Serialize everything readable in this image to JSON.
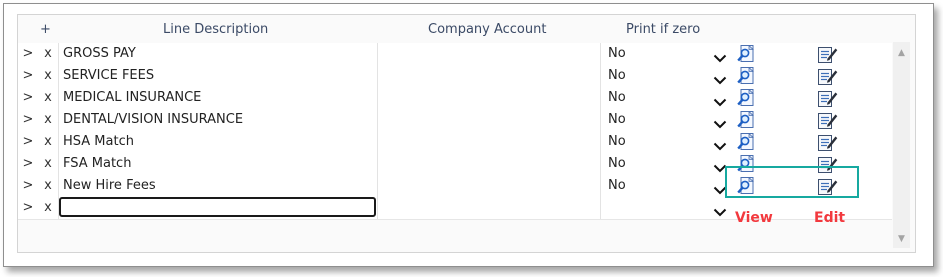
{
  "columns": {
    "add": "+",
    "description": "Line Description",
    "company_account": "Company Account",
    "print_if_zero": "Print if zero"
  },
  "row_controls": {
    "expand": ">",
    "delete": "x"
  },
  "rows": [
    {
      "description": "GROSS PAY",
      "company_account": "",
      "print_if_zero": "No"
    },
    {
      "description": "SERVICE FEES",
      "company_account": "",
      "print_if_zero": "No"
    },
    {
      "description": "MEDICAL INSURANCE",
      "company_account": "",
      "print_if_zero": "No"
    },
    {
      "description": "DENTAL/VISION INSURANCE",
      "company_account": "",
      "print_if_zero": "No"
    },
    {
      "description": "HSA Match",
      "company_account": "",
      "print_if_zero": "No"
    },
    {
      "description": "FSA Match",
      "company_account": "",
      "print_if_zero": "No"
    },
    {
      "description": "New Hire Fees",
      "company_account": "",
      "print_if_zero": "No"
    }
  ],
  "new_row": {
    "description": "",
    "print_if_zero": ""
  },
  "icons": {
    "view": "magnifier-page-icon",
    "edit": "edit-page-icon",
    "dropdown": "chevron-down-icon"
  },
  "callouts": {
    "view": "View",
    "edit": "Edit"
  },
  "colors": {
    "highlight": "#16a9a0",
    "callout_text": "#f2393e",
    "header_text": "#3b4a66"
  }
}
